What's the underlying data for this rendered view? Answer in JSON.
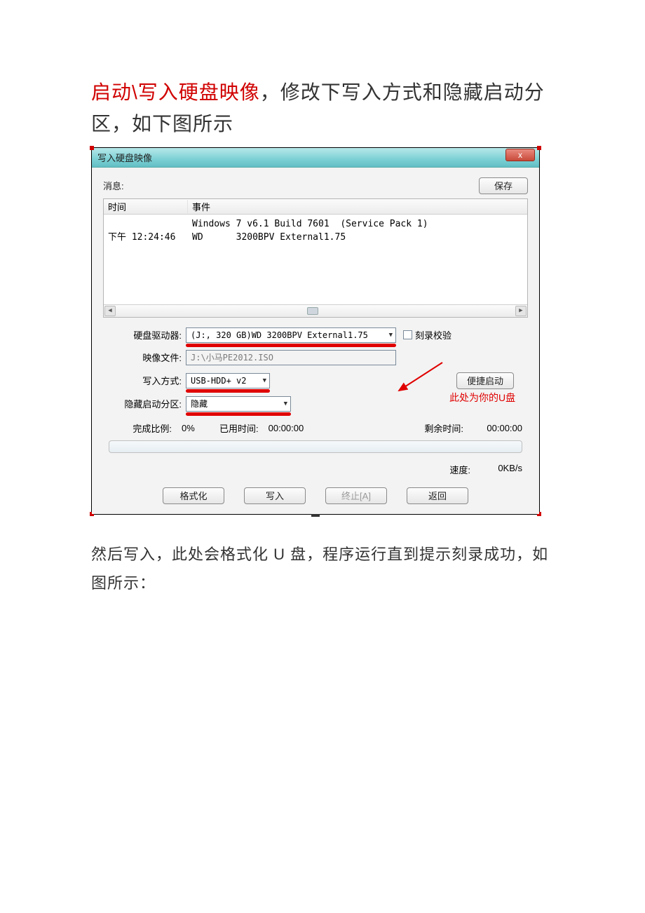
{
  "instruction": {
    "red_part": "启动\\写入硬盘映像",
    "black_part": "，修改下写入方式和隐藏启动分区，如下图所示"
  },
  "dialog": {
    "title": "写入硬盘映像",
    "close_x": "x",
    "message_label": "消息:",
    "save_button": "保存",
    "log": {
      "col_time": "时间",
      "col_event": "事件",
      "row1_event": "Windows 7 v6.1 Build 7601  (Service Pack 1)",
      "row2_time": "下午 12:24:46",
      "row2_event": "WD      3200BPV External1.75"
    },
    "fields": {
      "drive_label": "硬盘驱动器:",
      "drive_value": "(J:, 320 GB)WD      3200BPV External1.75",
      "verify_label": "刻录校验",
      "image_label": "映像文件:",
      "image_value": "J:\\小马PE2012.ISO",
      "write_mode_label": "写入方式:",
      "write_mode_value": "USB-HDD+ v2",
      "quick_boot": "便捷启动",
      "hide_label": "隐藏启动分区:",
      "hide_value": "隐藏",
      "annotation": "此处为你的U盘"
    },
    "progress": {
      "done_label": "完成比例:",
      "done_value": "0%",
      "elapsed_label": "已用时间:",
      "elapsed_value": "00:00:00",
      "remain_label": "剩余时间:",
      "remain_value": "00:00:00",
      "speed_label": "速度:",
      "speed_value": "0KB/s"
    },
    "buttons": {
      "format": "格式化",
      "write": "写入",
      "stop": "终止[A]",
      "back": "返回"
    }
  },
  "after_text": "然后写入，此处会格式化 U 盘，程序运行直到提示刻录成功，如图所示："
}
